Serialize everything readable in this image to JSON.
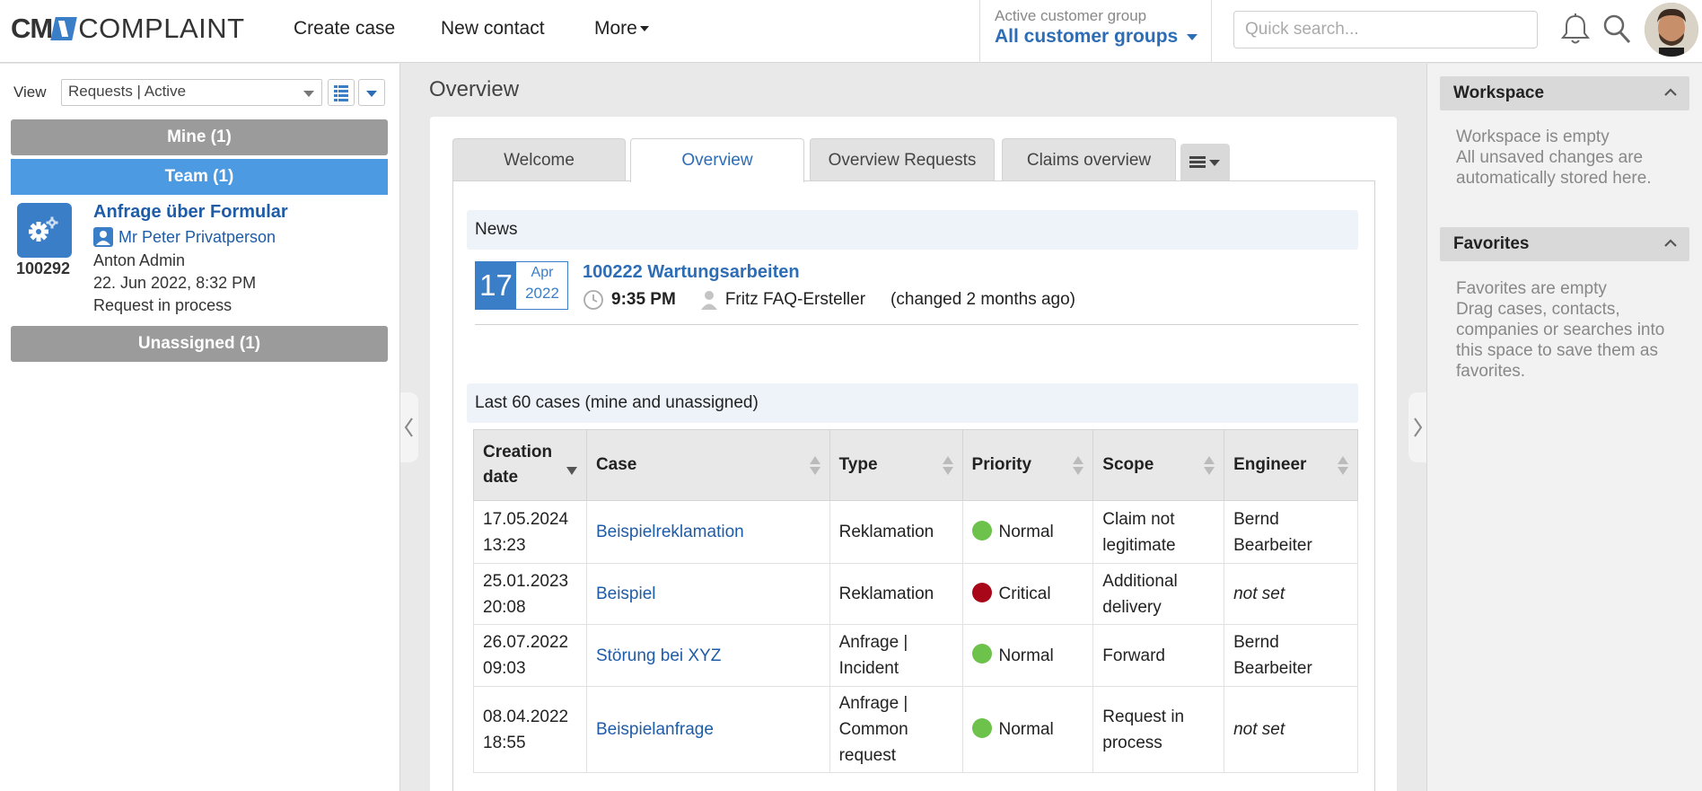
{
  "header": {
    "logo_cm": "CM",
    "logo_word": "COMPLAINT",
    "nav": {
      "create_case": "Create case",
      "new_contact": "New contact",
      "more": "More"
    },
    "customer_group": {
      "label": "Active customer group",
      "value": "All customer groups"
    },
    "search_placeholder": "Quick search..."
  },
  "left": {
    "view_label": "View",
    "view_value": "Requests | Active",
    "groups": {
      "mine": "Mine (1)",
      "team": "Team (1)",
      "unassigned": "Unassigned (1)"
    },
    "case": {
      "number": "100292",
      "title": "Anfrage über Formular",
      "contact": "Mr Peter Privatperson",
      "agent": "Anton Admin",
      "date": "22. Jun 2022, 8:32 PM",
      "status": "Request in process"
    }
  },
  "main": {
    "page_title": "Overview",
    "tabs": [
      "Welcome",
      "Overview",
      "Overview Requests",
      "Claims overview"
    ],
    "news": {
      "heading": "News",
      "day": "17",
      "month": "Apr",
      "year": "2022",
      "title": "100222 Wartungsarbeiten",
      "time": "9:35 PM",
      "author": "Fritz FAQ-Ersteller",
      "changed": "(changed 2 months ago)"
    },
    "cases": {
      "heading": "Last 60 cases (mine and unassigned)",
      "columns": [
        "Creation date",
        "Case",
        "Type",
        "Priority",
        "Scope",
        "Engineer"
      ],
      "rows": [
        {
          "date": "17.05.2024 13:23",
          "case": "Beispielreklamation",
          "type": "Reklamation",
          "priority": "Normal",
          "priority_color": "#6cc24a",
          "scope": "Claim not legitimate",
          "engineer": "Bernd Bearbeiter"
        },
        {
          "date": "25.01.2023 20:08",
          "case": "Beispiel",
          "type": "Reklamation",
          "priority": "Critical",
          "priority_color": "#a8071a",
          "scope": "Additional delivery",
          "engineer": "not set"
        },
        {
          "date": "26.07.2022 09:03",
          "case": "Störung bei XYZ",
          "type": "Anfrage | Incident",
          "priority": "Normal",
          "priority_color": "#6cc24a",
          "scope": "Forward",
          "engineer": "Bernd Bearbeiter"
        },
        {
          "date": "08.04.2022 18:55",
          "case": "Beispielanfrage",
          "type": "Anfrage | Common request",
          "priority": "Normal",
          "priority_color": "#6cc24a",
          "scope": "Request in process",
          "engineer": "not set"
        }
      ]
    }
  },
  "right": {
    "workspace": {
      "title": "Workspace",
      "text": "Workspace is empty\nAll unsaved changes are automatically stored here."
    },
    "favorites": {
      "title": "Favorites",
      "text": "Favorites are empty\nDrag cases, contacts, companies or searches into this space to save them as favorites."
    }
  },
  "colors": {
    "accent": "#2d6db5",
    "team_bar": "#4b9ae2",
    "group_bar": "#9b9b9b",
    "normal": "#6cc24a",
    "critical": "#a8071a"
  },
  "icons": [
    "bell-icon",
    "search-icon",
    "avatar",
    "gear-icon",
    "person-icon",
    "clock-icon",
    "user-icon",
    "list-icon",
    "chevron-up-icon",
    "chevron-left-icon",
    "chevron-right-icon"
  ]
}
